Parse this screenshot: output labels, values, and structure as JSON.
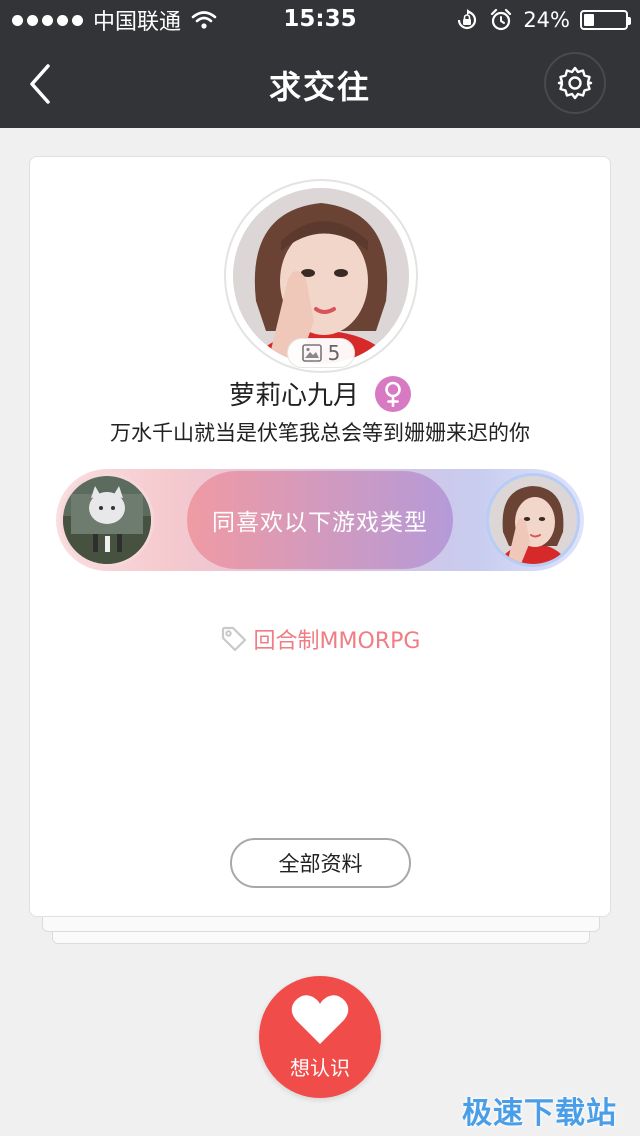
{
  "status_bar": {
    "carrier": "中国联通",
    "time": "15:35",
    "battery_text": "24%",
    "battery_level": 0.24
  },
  "nav": {
    "title": "求交往",
    "back_icon": "chevron-left-icon",
    "settings_icon": "gear-icon"
  },
  "profile": {
    "photo_count": "5",
    "name": "萝莉心九月",
    "gender": "female",
    "bio": "万水千山就当是伏笔我总会等到姗姗来迟的你"
  },
  "match": {
    "label": "同喜欢以下游戏类型"
  },
  "tags": [
    {
      "label": "回合制MMORPG",
      "icon": "tag-icon"
    }
  ],
  "actions": {
    "full_profile_label": "全部资料",
    "like_label": "想认识",
    "like_icon": "heart-icon"
  },
  "watermark": "极速下载站",
  "colors": {
    "nav_bg": "#323437",
    "accent_red": "#f04c4a",
    "tag_text": "#ef7d83",
    "gender_badge": "#d779c3",
    "match_gradient_start": "#f09aa3",
    "match_gradient_end": "#b59ad8"
  }
}
